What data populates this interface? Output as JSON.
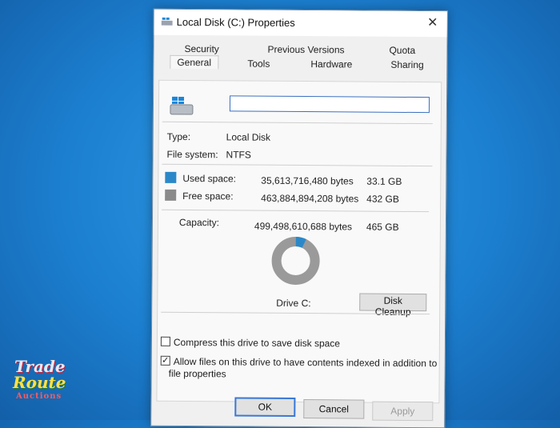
{
  "window": {
    "title": "Local Disk (C:) Properties",
    "close_glyph": "✕"
  },
  "tabs": {
    "row1": [
      "Security",
      "Previous Versions",
      "Quota"
    ],
    "row2": [
      "General",
      "Tools",
      "Hardware",
      "Sharing"
    ],
    "active": "General"
  },
  "general": {
    "name_value": "",
    "type_label": "Type:",
    "type_value": "Local Disk",
    "fs_label": "File system:",
    "fs_value": "NTFS",
    "used": {
      "label": "Used space:",
      "bytes": "35,613,716,480 bytes",
      "size": "33.1 GB",
      "color": "#2b88c8"
    },
    "free": {
      "label": "Free space:",
      "bytes": "463,884,894,208 bytes",
      "size": "432 GB",
      "color": "#8a8a8a"
    },
    "capacity": {
      "label": "Capacity:",
      "bytes": "499,498,610,688 bytes",
      "size": "465 GB"
    },
    "used_fraction": 0.0713,
    "drive_label": "Drive C:",
    "cleanup_label": "Disk Cleanup",
    "compress": {
      "label": "Compress this drive to save disk space",
      "checked": false
    },
    "index": {
      "label_line1": "Allow files on this drive to have contents indexed in addition to",
      "label_line2": "file properties",
      "checked": true
    }
  },
  "buttons": {
    "ok": "OK",
    "cancel": "Cancel",
    "apply": "Apply"
  },
  "watermark": {
    "line1": "Trade",
    "line2": "Route",
    "line3": "Auctions"
  },
  "icons": {
    "drive": "drive-icon",
    "window": "drive-small-icon",
    "close": "close-icon",
    "check": "checkmark-icon"
  }
}
